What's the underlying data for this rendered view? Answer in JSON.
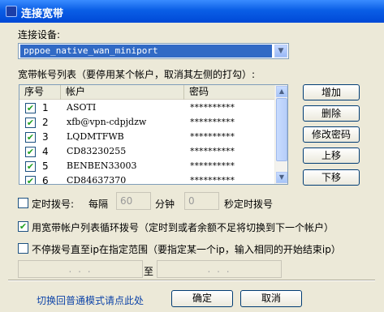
{
  "window": {
    "title": "连接宽带"
  },
  "device": {
    "label": "连接设备:",
    "selected": "pppoe_native_wan_miniport"
  },
  "accounts": {
    "list_label": "宽带帐号列表（要停用某个帐户，取消其左侧的打勾）:",
    "columns": [
      "序号",
      "帐户",
      "密码"
    ],
    "rows": [
      {
        "no": "1",
        "account": "ASOTI",
        "password": "**********",
        "checked": true
      },
      {
        "no": "2",
        "account": "xfb@vpn-cdpjdzw",
        "password": "**********",
        "checked": true
      },
      {
        "no": "3",
        "account": "LQDMTFWB",
        "password": "**********",
        "checked": true
      },
      {
        "no": "4",
        "account": "CD83230255",
        "password": "**********",
        "checked": true
      },
      {
        "no": "5",
        "account": "BENBEN33003",
        "password": "**********",
        "checked": true
      },
      {
        "no": "6",
        "account": "CD84637370",
        "password": "**********",
        "checked": true
      }
    ]
  },
  "side_buttons": {
    "add": "增加",
    "delete": "删除",
    "change_password": "修改密码",
    "move_up": "上移",
    "move_down": "下移"
  },
  "timed_dial": {
    "label": "定时拨号:",
    "every": "每隔",
    "minutes_value": "60",
    "minutes_unit": "分钟",
    "seconds_value": "0",
    "seconds_unit": "秒定时拨号",
    "checked": false
  },
  "cycle_dial": {
    "label": "用宽带帐户列表循环拨号（定时到或者余额不足将切换到下一个帐户）",
    "checked": true
  },
  "ip_range": {
    "label": "不停拨号直至ip在指定范围（要指定某一个ip，输入相同的开始结束ip）",
    "checked": false,
    "start_ip": ".   .   .",
    "to": "至",
    "end_ip": ".   .   ."
  },
  "footer": {
    "switch_link": "切换回普通模式请点此处",
    "ok": "确定",
    "cancel": "取消"
  }
}
